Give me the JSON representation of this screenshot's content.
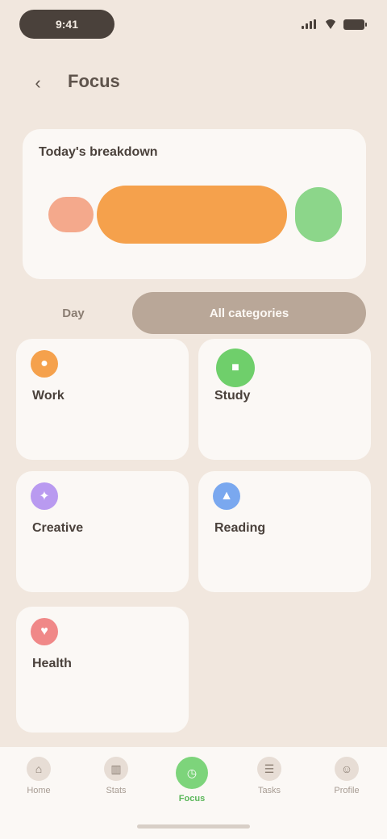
{
  "status": {
    "time": "9:41"
  },
  "header": {
    "title": "Focus"
  },
  "summary": {
    "title": "Today's breakdown",
    "segments": [
      {
        "label": "",
        "color": "#f4a98c"
      },
      {
        "label": "",
        "color": "#f5a14c"
      },
      {
        "label": "",
        "color": "#8cd68a"
      }
    ]
  },
  "tabs": [
    {
      "label": "Day"
    },
    {
      "label": "All categories"
    }
  ],
  "cards": [
    {
      "title": "Work",
      "sub": "",
      "meta": "",
      "icon": "briefcase-icon",
      "color": "#f5a14c"
    },
    {
      "title": "Study",
      "sub": "",
      "meta": "",
      "icon": "book-icon",
      "color": "#6fcf6b"
    },
    {
      "title": "Creative",
      "sub": "",
      "meta": "",
      "icon": "palette-icon",
      "color": "#b99af0"
    },
    {
      "title": "Reading",
      "sub": "",
      "meta": "",
      "icon": "bookmark-icon",
      "color": "#7aa8ef"
    },
    {
      "title": "Health",
      "sub": "",
      "meta": "",
      "icon": "heart-icon",
      "color": "#f08888"
    }
  ],
  "nav": [
    {
      "label": "Home",
      "icon": "home-icon"
    },
    {
      "label": "Stats",
      "icon": "chart-icon"
    },
    {
      "label": "Focus",
      "icon": "timer-icon"
    },
    {
      "label": "Tasks",
      "icon": "list-icon"
    },
    {
      "label": "Profile",
      "icon": "user-icon"
    }
  ]
}
